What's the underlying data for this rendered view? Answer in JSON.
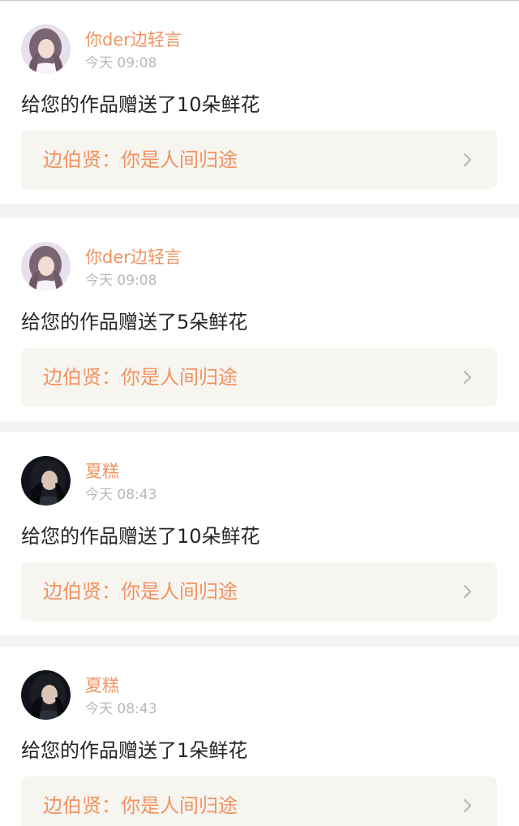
{
  "notifications": [
    {
      "username": "你der边轻言",
      "time": "今天 09:08",
      "message": "给您的作品赠送了10朵鲜花",
      "work_title": "边伯贤：你是人间归途",
      "avatar_style": "light-hair-girl"
    },
    {
      "username": "你der边轻言",
      "time": "今天 09:08",
      "message": "给您的作品赠送了5朵鲜花",
      "work_title": "边伯贤：你是人间归途",
      "avatar_style": "light-hair-girl"
    },
    {
      "username": "夏糕",
      "time": "今天 08:43",
      "message": "给您的作品赠送了10朵鲜花",
      "work_title": "边伯贤：你是人间归途",
      "avatar_style": "dark-hair-girl"
    },
    {
      "username": "夏糕",
      "time": "今天 08:43",
      "message": "给您的作品赠送了1朵鲜花",
      "work_title": "边伯贤：你是人间归途",
      "avatar_style": "dark-hair-girl"
    }
  ],
  "colors": {
    "accent": "#f19362",
    "timestamp": "#b8b8b8",
    "message_text": "#262626",
    "work_background": "#f6f5f0",
    "page_background": "#f4f4f4"
  },
  "icons": {
    "chevron": "chevron-right-icon"
  }
}
